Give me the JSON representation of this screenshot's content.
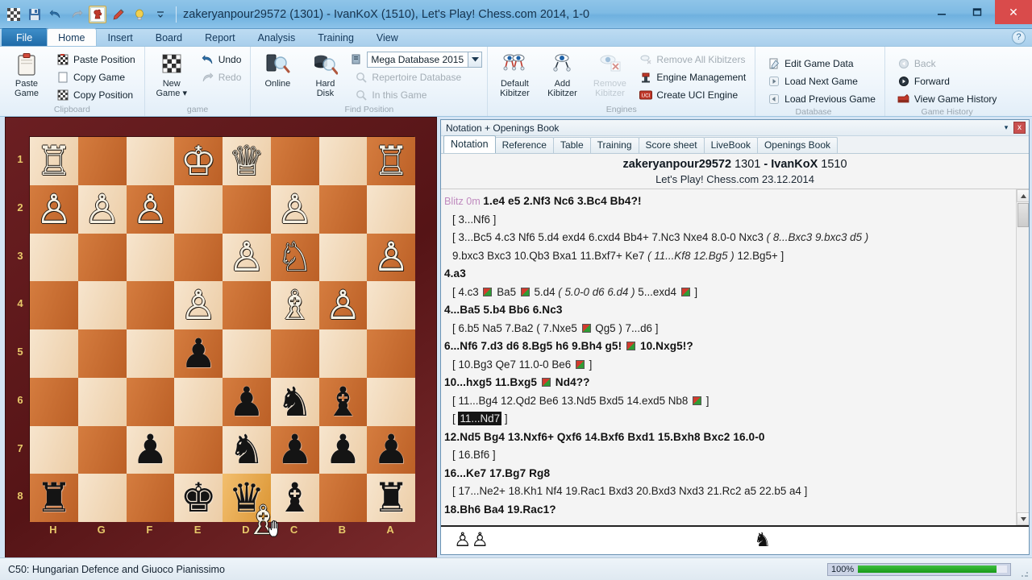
{
  "window": {
    "title": "zakeryanpour29572 (1301) - IvanKoX (1510), Let's Play! Chess.com 2014, 1-0",
    "minimize_label": "—",
    "maximize_label": "❑",
    "close_label": "✕"
  },
  "quick_access": [
    {
      "name": "board-icon",
      "glyph": "░"
    },
    {
      "name": "save-icon",
      "glyph": "💾"
    },
    {
      "name": "undo-icon",
      "glyph": "↶"
    },
    {
      "name": "redo-icon",
      "glyph": "↷"
    },
    {
      "name": "chessbase-icon",
      "glyph": "♞"
    },
    {
      "name": "pen-icon",
      "glyph": "✒"
    },
    {
      "name": "lightbulb-icon",
      "glyph": "💡"
    },
    {
      "name": "customize-qat-icon",
      "glyph": "▾"
    }
  ],
  "ribbon_tabs": [
    {
      "label": "File",
      "selected": false,
      "is_file": true
    },
    {
      "label": "Home",
      "selected": true
    },
    {
      "label": "Insert",
      "selected": false
    },
    {
      "label": "Board",
      "selected": false
    },
    {
      "label": "Report",
      "selected": false
    },
    {
      "label": "Analysis",
      "selected": false
    },
    {
      "label": "Training",
      "selected": false
    },
    {
      "label": "View",
      "selected": false
    }
  ],
  "help_icon": "?",
  "ribbon_groups": [
    {
      "title": "Clipboard",
      "big": {
        "label_line1": "Paste",
        "label_line2": "Game",
        "icon": "clipboard-icon"
      },
      "items": [
        {
          "label": "Paste Position",
          "icon": "paste-position-icon",
          "disabled": false
        },
        {
          "label": "Copy Game",
          "icon": "copy-game-icon",
          "disabled": false
        },
        {
          "label": "Copy Position",
          "icon": "copy-position-icon",
          "disabled": false
        }
      ]
    },
    {
      "title": "game",
      "big": {
        "label_line1": "New",
        "label_line2": "Game ▾",
        "icon": "new-game-icon"
      },
      "items": [
        {
          "label": "Undo",
          "icon": "undo-icon",
          "disabled": false
        },
        {
          "label": "Redo",
          "icon": "redo-icon",
          "disabled": true
        }
      ]
    },
    {
      "title": "Find Position",
      "bigs": [
        {
          "label_line1": "Online",
          "label_line2": "",
          "icon": "online-search-icon"
        },
        {
          "label_line1": "Hard",
          "label_line2": "Disk",
          "icon": "harddisk-search-icon"
        }
      ],
      "database_value": "Mega Database 2015",
      "items": [
        {
          "label": "Repertoire Database",
          "icon": "repertoire-icon",
          "disabled": true
        },
        {
          "label": "In this Game",
          "icon": "in-this-game-icon",
          "disabled": true
        }
      ]
    },
    {
      "title": "Engines",
      "bigs": [
        {
          "label_line1": "Default",
          "label_line2": "Kibitzer",
          "icon": "default-kibitzer-icon"
        },
        {
          "label_line1": "Add",
          "label_line2": "Kibitzer",
          "icon": "add-kibitzer-icon"
        },
        {
          "label_line1": "Remove",
          "label_line2": "Kibitzer",
          "icon": "remove-kibitzer-icon",
          "disabled": true
        }
      ],
      "items": [
        {
          "label": "Remove All Kibitzers",
          "icon": "remove-all-kibitzers-icon",
          "disabled": true
        },
        {
          "label": "Engine Management",
          "icon": "engine-management-icon",
          "disabled": false
        },
        {
          "label": "Create UCI Engine",
          "icon": "uci-icon",
          "disabled": false
        }
      ]
    },
    {
      "title": "Database",
      "items": [
        {
          "label": "Edit Game Data",
          "icon": "edit-game-data-icon",
          "disabled": false
        },
        {
          "label": "Load Next Game",
          "icon": "next-game-icon",
          "disabled": false
        },
        {
          "label": "Load Previous Game",
          "icon": "previous-game-icon",
          "disabled": false
        }
      ]
    },
    {
      "title": "Game History",
      "items": [
        {
          "label": "Back",
          "icon": "back-icon",
          "disabled": true
        },
        {
          "label": "Forward",
          "icon": "forward-icon",
          "disabled": false
        },
        {
          "label": "View Game History",
          "icon": "view-game-history-icon",
          "disabled": false
        }
      ]
    }
  ],
  "board": {
    "orientation": "black",
    "file_labels": [
      "H",
      "G",
      "F",
      "E",
      "D",
      "C",
      "B",
      "A"
    ],
    "rank_labels": [
      "1",
      "2",
      "3",
      "4",
      "5",
      "6",
      "7",
      "8"
    ],
    "light_color": "#f2d7b3",
    "dark_color": "#c96a2c",
    "frame_color": "#6b1f22",
    "label_color": "#e8c96a",
    "highlight_square": "d8",
    "rows": [
      [
        {
          "sq": "h1",
          "piece": "♖",
          "color": "w"
        },
        {
          "sq": "g1",
          "piece": "",
          "color": ""
        },
        {
          "sq": "f1",
          "piece": "",
          "color": ""
        },
        {
          "sq": "e1",
          "piece": "♔",
          "color": "w"
        },
        {
          "sq": "d1",
          "piece": "♕",
          "color": "w"
        },
        {
          "sq": "c1",
          "piece": "",
          "color": ""
        },
        {
          "sq": "b1",
          "piece": "",
          "color": ""
        },
        {
          "sq": "a1",
          "piece": "♖",
          "color": "w"
        }
      ],
      [
        {
          "sq": "h2",
          "piece": "♙",
          "color": "w"
        },
        {
          "sq": "g2",
          "piece": "♙",
          "color": "w"
        },
        {
          "sq": "f2",
          "piece": "♙",
          "color": "w"
        },
        {
          "sq": "e2",
          "piece": "",
          "color": ""
        },
        {
          "sq": "d2",
          "piece": "",
          "color": ""
        },
        {
          "sq": "c2",
          "piece": "♙",
          "color": "w"
        },
        {
          "sq": "b2",
          "piece": "",
          "color": ""
        },
        {
          "sq": "a2",
          "piece": "",
          "color": ""
        }
      ],
      [
        {
          "sq": "h3",
          "piece": "",
          "color": ""
        },
        {
          "sq": "g3",
          "piece": "",
          "color": ""
        },
        {
          "sq": "f3",
          "piece": "",
          "color": ""
        },
        {
          "sq": "e3",
          "piece": "",
          "color": ""
        },
        {
          "sq": "d3",
          "piece": "♙",
          "color": "w"
        },
        {
          "sq": "c3",
          "piece": "♘",
          "color": "w"
        },
        {
          "sq": "b3",
          "piece": "",
          "color": ""
        },
        {
          "sq": "a3",
          "piece": "♙",
          "color": "w"
        }
      ],
      [
        {
          "sq": "h4",
          "piece": "",
          "color": ""
        },
        {
          "sq": "g4",
          "piece": "",
          "color": ""
        },
        {
          "sq": "f4",
          "piece": "",
          "color": ""
        },
        {
          "sq": "e4",
          "piece": "♙",
          "color": "w"
        },
        {
          "sq": "d4",
          "piece": "",
          "color": ""
        },
        {
          "sq": "c4",
          "piece": "♗",
          "color": "w"
        },
        {
          "sq": "b4",
          "piece": "♙",
          "color": "w"
        },
        {
          "sq": "a4",
          "piece": "",
          "color": ""
        }
      ],
      [
        {
          "sq": "h5",
          "piece": "",
          "color": ""
        },
        {
          "sq": "g5",
          "piece": "",
          "color": ""
        },
        {
          "sq": "f5",
          "piece": "",
          "color": ""
        },
        {
          "sq": "e5",
          "piece": "♟",
          "color": "b"
        },
        {
          "sq": "d5",
          "piece": "",
          "color": ""
        },
        {
          "sq": "c5",
          "piece": "",
          "color": ""
        },
        {
          "sq": "b5",
          "piece": "",
          "color": ""
        },
        {
          "sq": "a5",
          "piece": "",
          "color": ""
        }
      ],
      [
        {
          "sq": "h6",
          "piece": "",
          "color": ""
        },
        {
          "sq": "g6",
          "piece": "",
          "color": ""
        },
        {
          "sq": "f6",
          "piece": "",
          "color": ""
        },
        {
          "sq": "e6",
          "piece": "",
          "color": ""
        },
        {
          "sq": "d6",
          "piece": "♟",
          "color": "b"
        },
        {
          "sq": "c6",
          "piece": "♞",
          "color": "b"
        },
        {
          "sq": "b6",
          "piece": "♝",
          "color": "b"
        },
        {
          "sq": "a6",
          "piece": "",
          "color": ""
        }
      ],
      [
        {
          "sq": "h7",
          "piece": "",
          "color": ""
        },
        {
          "sq": "g7",
          "piece": "",
          "color": ""
        },
        {
          "sq": "f7",
          "piece": "♟",
          "color": "b"
        },
        {
          "sq": "e7",
          "piece": "",
          "color": ""
        },
        {
          "sq": "d7",
          "piece": "♞",
          "color": "b"
        },
        {
          "sq": "c7",
          "piece": "♟",
          "color": "b"
        },
        {
          "sq": "b7",
          "piece": "♟",
          "color": "b"
        },
        {
          "sq": "a7",
          "piece": "♟",
          "color": "b"
        }
      ],
      [
        {
          "sq": "h8",
          "piece": "♜",
          "color": "b"
        },
        {
          "sq": "g8",
          "piece": "",
          "color": ""
        },
        {
          "sq": "f8",
          "piece": "",
          "color": ""
        },
        {
          "sq": "e8",
          "piece": "♚",
          "color": "b"
        },
        {
          "sq": "d8",
          "piece": "♛",
          "color": "b"
        },
        {
          "sq": "c8",
          "piece": "♝",
          "color": "b"
        },
        {
          "sq": "b8",
          "piece": "",
          "color": ""
        },
        {
          "sq": "a8",
          "piece": "♜",
          "color": "b"
        }
      ]
    ],
    "dragging_piece": "♗",
    "cursor_glyph": "✋"
  },
  "notation": {
    "panel_title": "Notation + Openings Book",
    "caret_glyph": "▾",
    "close_glyph": "x",
    "tabs": [
      {
        "label": "Notation",
        "selected": true
      },
      {
        "label": "Reference",
        "selected": false
      },
      {
        "label": "Table",
        "selected": false
      },
      {
        "label": "Training",
        "selected": false
      },
      {
        "label": "Score sheet",
        "selected": false
      },
      {
        "label": "LiveBook",
        "selected": false
      },
      {
        "label": "Openings Book",
        "selected": false
      }
    ],
    "white_player": "zakeryanpour29572",
    "white_elo": "1301",
    "dash": "-",
    "black_player": "IvanKoX",
    "black_elo": "1510",
    "event": "Let's Play! Chess.com 23.12.2014",
    "time_control": "Blitz 0m",
    "lines": [
      {
        "kind": "main",
        "prefix": "blitz",
        "text": "1.e4  e5  2.Nf3  Nc6  3.Bc4  Bb4?!"
      },
      {
        "kind": "var",
        "text": "[ 3...Nf6 ]"
      },
      {
        "kind": "var",
        "text": "[ 3...Bc5  4.c3  Nf6  5.d4  exd4  6.cxd4  Bb4+  7.Nc3  Nxe4  8.0-0  Nxc3  ( 8...Bxc3  9.bxc3  d5 )"
      },
      {
        "kind": "var",
        "text": "9.bxc3  Bxc3  10.Qb3  Bxa1  11.Bxf7+  Ke7  ( 11...Kf8  12.Bg5 ) 12.Bg5+ ]"
      },
      {
        "kind": "main",
        "text": "4.a3"
      },
      {
        "kind": "var",
        "text": "[ 4.c3 ▣ Ba5 ▣ 5.d4  ( 5.0-0  d6  6.d4 ) 5...exd4 ▣ ]"
      },
      {
        "kind": "main",
        "text": "4...Ba5  5.b4  Bb6  6.Nc3"
      },
      {
        "kind": "var",
        "text": "[ 6.b5  Na5  7.Ba2  ( 7.Nxe5 ▣ Qg5 ) 7...d6 ]"
      },
      {
        "kind": "main",
        "text": "6...Nf6  7.d3  d6  8.Bg5  h6  9.Bh4  g5! ▣ 10.Nxg5!?"
      },
      {
        "kind": "var",
        "text": "[ 10.Bg3  Qe7  11.0-0  Be6 ▣ ]"
      },
      {
        "kind": "main",
        "text": "10...hxg5  11.Bxg5 ▣ Nd4??"
      },
      {
        "kind": "var",
        "text": "[ 11...Bg4  12.Qd2  Be6  13.Nd5  Bxd5  14.exd5  Nb8 ▣ ]"
      },
      {
        "kind": "var",
        "selected_text": "11...Nd7",
        "text": "[ ]"
      },
      {
        "kind": "main",
        "text": "12.Nd5  Bg4  13.Nxf6+  Qxf6  14.Bxf6  Bxd1  15.Bxh8  Bxc2  16.0-0"
      },
      {
        "kind": "var",
        "text": "[ 16.Bf6 ]"
      },
      {
        "kind": "main",
        "text": "16...Ke7  17.Bg7  Rg8"
      },
      {
        "kind": "var",
        "text": "[ 17...Ne2+  18.Kh1  Nf4  19.Rac1  Bxd3  20.Bxd3  Nxd3  21.Rc2  a5  22.b5  a4 ]"
      },
      {
        "kind": "main",
        "text": "18.Bh6  Ba4  19.Rac1?"
      }
    ],
    "material": {
      "white_pieces": "♙♙",
      "black_pieces": "♞"
    }
  },
  "status": {
    "eco": "C50: Hungarian Defence and Giuoco Pianissimo",
    "progress_percent": "100%",
    "progress_value": 100
  }
}
